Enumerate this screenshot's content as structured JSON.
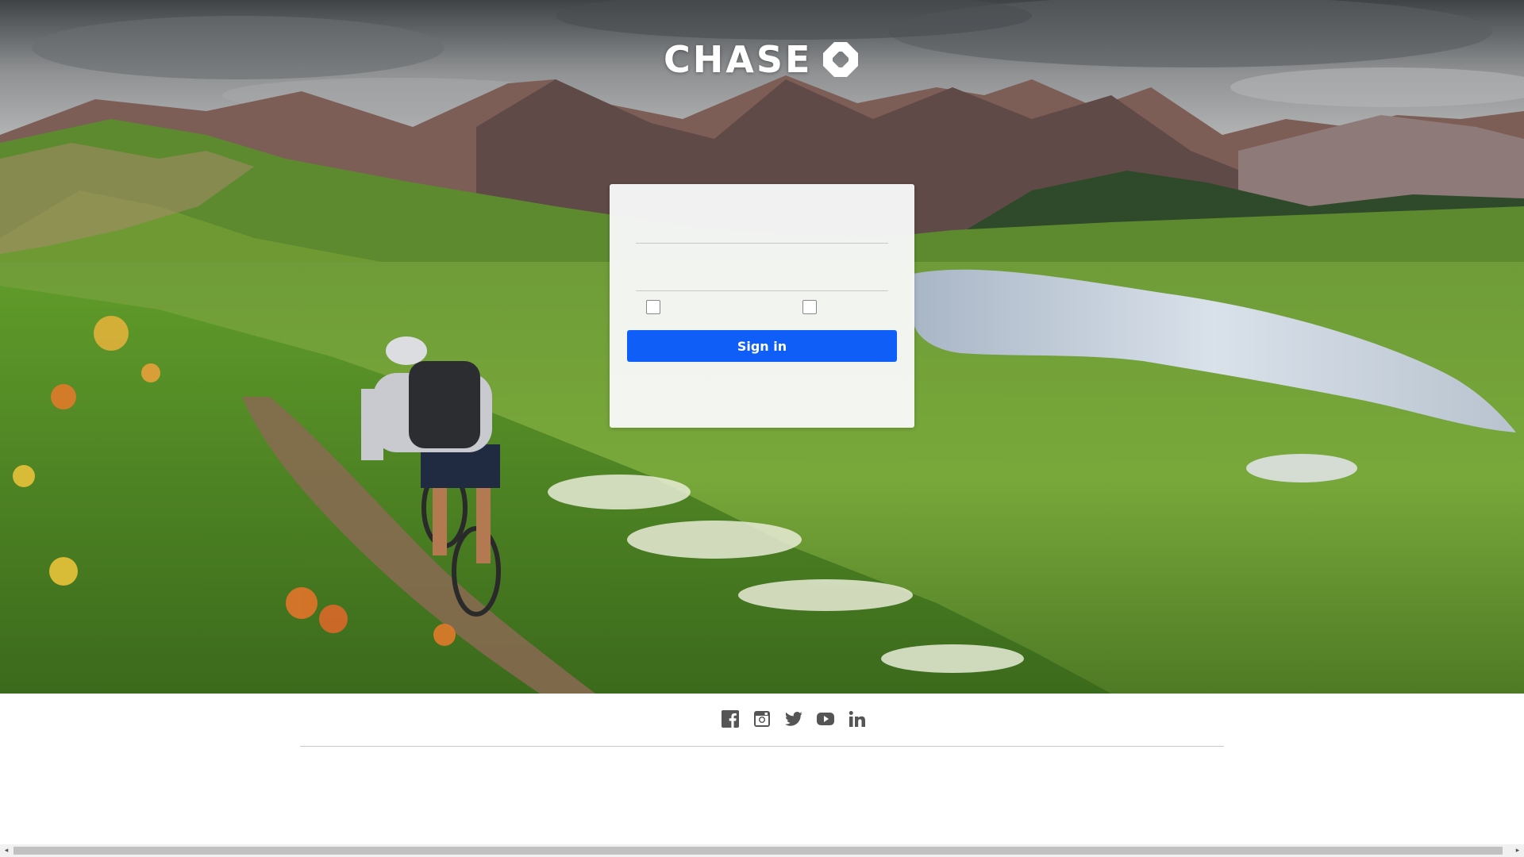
{
  "brand": {
    "name": "CHASE",
    "logo_icon": "chase-octagon-icon",
    "accent_color": "#0f5ef7"
  },
  "login": {
    "username_value": "",
    "password_value": "",
    "remember_label": "",
    "token_label": "",
    "signin_label": "Sign in"
  },
  "footer": {
    "social": [
      {
        "name": "facebook-icon"
      },
      {
        "name": "instagram-icon"
      },
      {
        "name": "twitter-icon"
      },
      {
        "name": "youtube-icon"
      },
      {
        "name": "linkedin-icon"
      }
    ],
    "icon_color": "#555555"
  }
}
